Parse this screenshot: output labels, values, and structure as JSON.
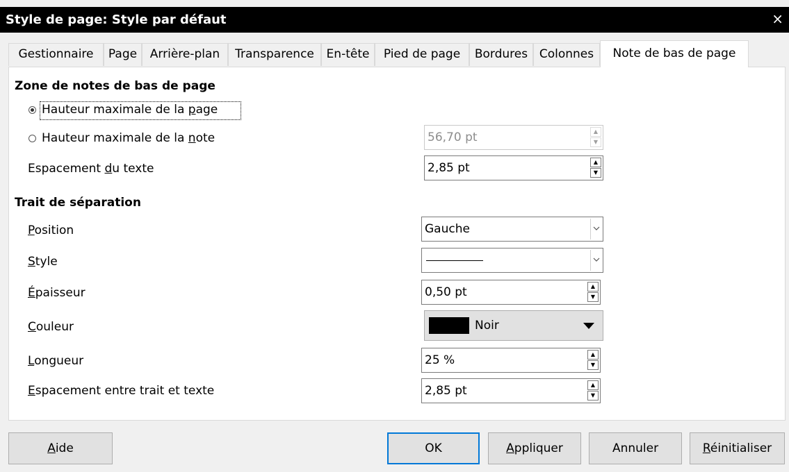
{
  "window": {
    "title": "Style de page: Style par défaut",
    "close": "×"
  },
  "tabs": [
    {
      "label": "Gestionnaire"
    },
    {
      "label": "Page"
    },
    {
      "label": "Arrière-plan"
    },
    {
      "label": "Transparence"
    },
    {
      "label": "En-tête"
    },
    {
      "label": "Pied de page"
    },
    {
      "label": "Bordures"
    },
    {
      "label": "Colonnes"
    },
    {
      "label": "Note de bas de page"
    }
  ],
  "active_tab": "Note de bas de page",
  "footnote_area": {
    "heading": "Zone de notes de bas de page",
    "max_page_height": {
      "label_pre": "Hauteur maximale de la ",
      "label_key": "p",
      "label_post": "age",
      "selected": true
    },
    "max_note_height": {
      "label_pre": "Hauteur maximale de la ",
      "label_key": "n",
      "label_post": "ote",
      "value": "56,70 pt",
      "selected": false
    },
    "text_spacing": {
      "label_pre": "Espacement ",
      "label_key": "d",
      "label_post": "u texte",
      "value": "2,85 pt"
    }
  },
  "separator_line": {
    "heading": "Trait de séparation",
    "position": {
      "label_key": "P",
      "label_post": "osition",
      "value": "Gauche"
    },
    "style": {
      "label_key": "S",
      "label_post": "tyle"
    },
    "thickness": {
      "label_key": "É",
      "label_post": "paisseur",
      "value": "0,50 pt"
    },
    "color": {
      "label_key": "C",
      "label_post": "ouleur",
      "value": "Noir",
      "swatch": "#000000"
    },
    "length": {
      "label_key": "L",
      "label_post": "ongueur",
      "value": "25 %"
    },
    "spacing": {
      "label_key": "E",
      "label_post": "spacement entre trait et texte",
      "value": "2,85 pt"
    }
  },
  "buttons": {
    "help": {
      "key": "A",
      "rest": "ide"
    },
    "ok": "OK",
    "apply": {
      "key": "A",
      "rest": "ppliquer"
    },
    "cancel": "Annuler",
    "reset": {
      "key": "R",
      "rest": "éinitialiser"
    }
  },
  "colors": {
    "focus_border": "#0078d7",
    "titlebar": "#000000"
  }
}
